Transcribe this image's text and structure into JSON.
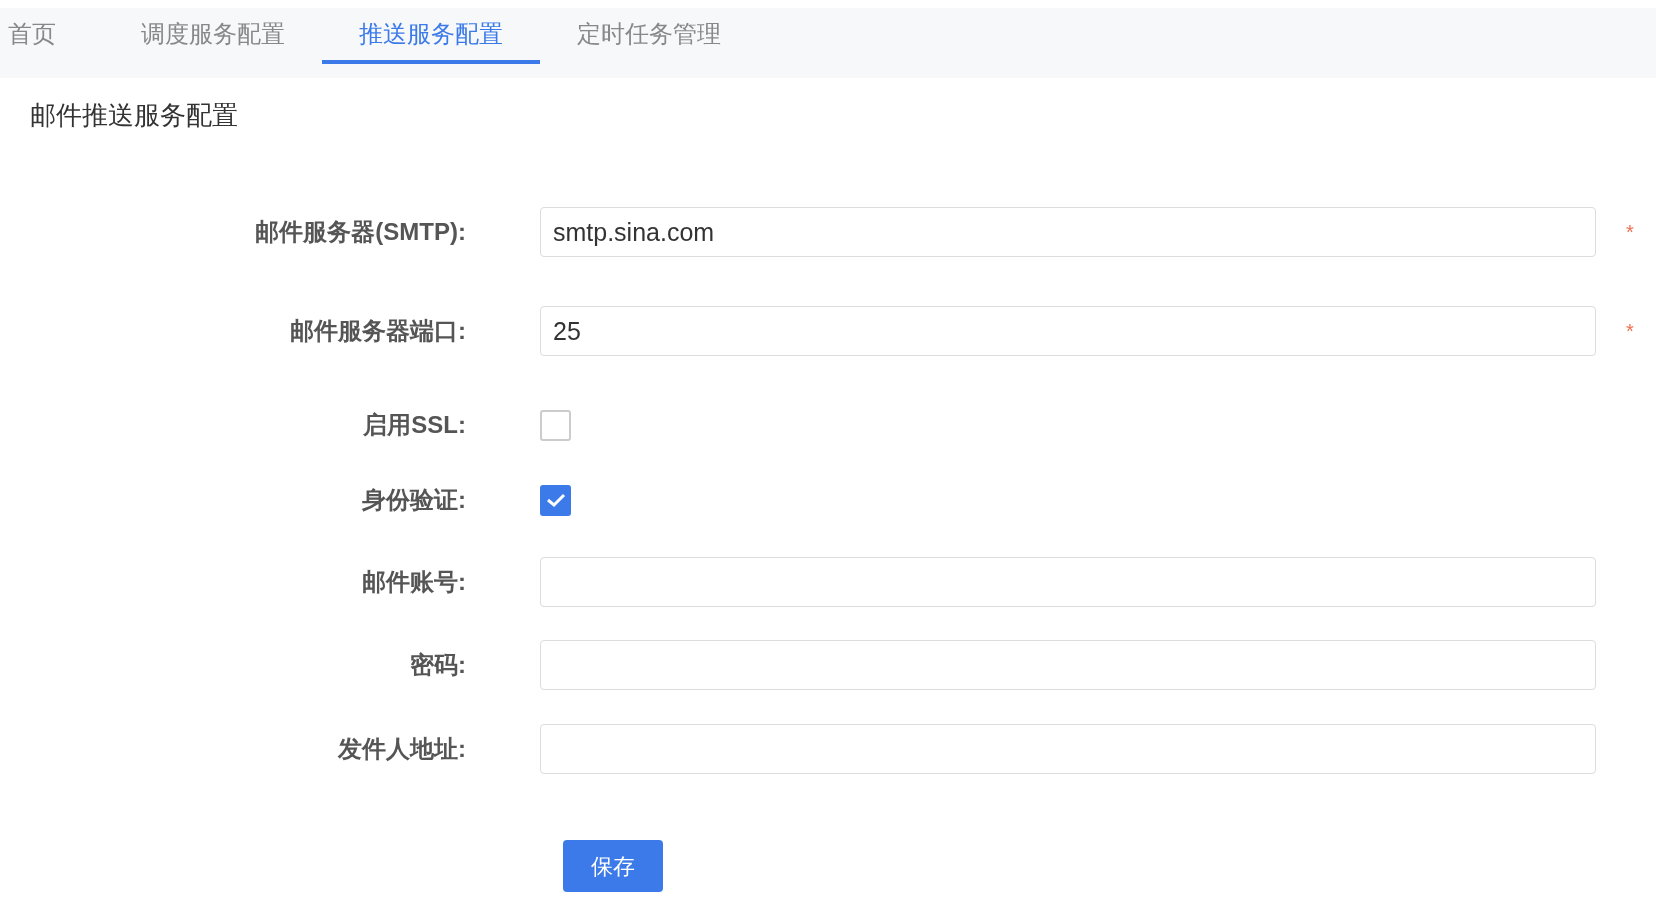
{
  "tabs": [
    {
      "label": "首页",
      "selected": false
    },
    {
      "label": "调度服务配置",
      "selected": false
    },
    {
      "label": "推送服务配置",
      "selected": true
    },
    {
      "label": "定时任务管理",
      "selected": false
    }
  ],
  "section_title": "邮件推送服务配置",
  "fields": [
    {
      "kind": "text",
      "label": "邮件服务器(SMTP):",
      "value": "smtp.sina.com",
      "required": true
    },
    {
      "kind": "text",
      "label": "邮件服务器端口:",
      "value": "25",
      "required": true
    },
    {
      "kind": "checkbox",
      "label": "启用SSL:",
      "checked": false
    },
    {
      "kind": "checkbox",
      "label": "身份验证:",
      "checked": true
    },
    {
      "kind": "text",
      "label": "邮件账号:",
      "required": false
    },
    {
      "kind": "password",
      "label": "密码:",
      "required": false
    },
    {
      "kind": "text",
      "label": "发件人地址:",
      "required": false
    }
  ],
  "required_mark": "*",
  "save_button": "保存"
}
